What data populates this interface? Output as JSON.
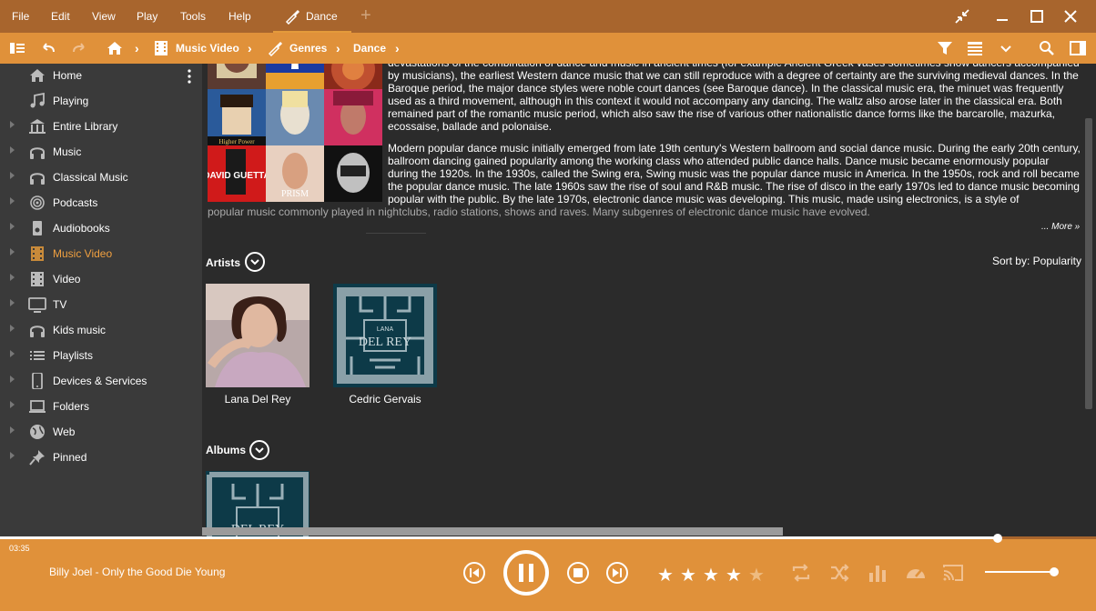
{
  "menu": {
    "items": [
      "File",
      "Edit",
      "View",
      "Play",
      "Tools",
      "Help"
    ]
  },
  "tab": {
    "label": "Dance"
  },
  "breadcrumb": {
    "items": [
      "Music Video",
      "Genres",
      "Dance"
    ]
  },
  "sidebar": {
    "items": [
      {
        "label": "Home",
        "icon": "home-icon"
      },
      {
        "label": "Playing",
        "icon": "music-note-icon"
      },
      {
        "label": "Entire Library",
        "icon": "library-icon"
      },
      {
        "label": "Music",
        "icon": "headphones-icon"
      },
      {
        "label": "Classical Music",
        "icon": "headphones-icon"
      },
      {
        "label": "Podcasts",
        "icon": "podcast-icon"
      },
      {
        "label": "Audiobooks",
        "icon": "audiobook-icon"
      },
      {
        "label": "Music Video",
        "icon": "film-icon",
        "active": true
      },
      {
        "label": "Video",
        "icon": "film-icon"
      },
      {
        "label": "TV",
        "icon": "tv-icon"
      },
      {
        "label": "Kids music",
        "icon": "headphones-icon"
      },
      {
        "label": "Playlists",
        "icon": "playlist-icon"
      },
      {
        "label": "Devices & Services",
        "icon": "device-icon"
      },
      {
        "label": "Folders",
        "icon": "laptop-icon"
      },
      {
        "label": "Web",
        "icon": "globe-icon"
      },
      {
        "label": "Pinned",
        "icon": "pin-icon"
      }
    ]
  },
  "description": {
    "para1": "devastations of the combination of dance and music in ancient times (for example Ancient Greek vases sometimes show dancers accompanied by musicians), the earliest Western dance music that we can still reproduce with a degree of certainty are the surviving medieval dances. In the Baroque period, the major dance styles were noble court dances (see Baroque dance). In the classical music era, the minuet was frequently used as a third movement, although in this context it would not accompany any dancing. The waltz also arose later in the classical era. Both remained part of the romantic music period, which also saw the rise of various other nationalistic dance forms like the barcarolle, mazurka, ecossaise, ballade and polonaise.",
    "para2": "Modern popular dance music initially emerged from late 19th century's Western ballroom and social dance music. During the early 20th century, ballroom dancing gained popularity among the working class who attended public dance halls. Dance music became enormously popular during the 1920s. In the 1930s, called the Swing era, Swing music was the popular dance music in America. In the 1950s, rock and roll became the popular dance music. The late 1960s saw the rise of soul and R&B music. The rise of disco in the early 1970s led to dance music becoming popular with the public. By the late 1970s, electronic dance music was developing. This music, made using electronics, is a style of",
    "para2_fade": "popular music commonly played in nightclubs, radio stations, shows and raves. Many subgenres of electronic dance music have evolved.",
    "more": "... More »"
  },
  "artists": {
    "title": "Artists",
    "sort": "Sort by: Popularity",
    "items": [
      "Lana Del Rey",
      "Cedric Gervais"
    ]
  },
  "albums": {
    "title": "Albums"
  },
  "player": {
    "time": "03:35",
    "track": "Billy Joel - Only the Good Die Young",
    "progress": 0.91,
    "rating": 4,
    "volume": 0.95
  },
  "colors": {
    "titlebar": "#a8652d",
    "accent": "#e0913a",
    "active": "#f0a040"
  }
}
